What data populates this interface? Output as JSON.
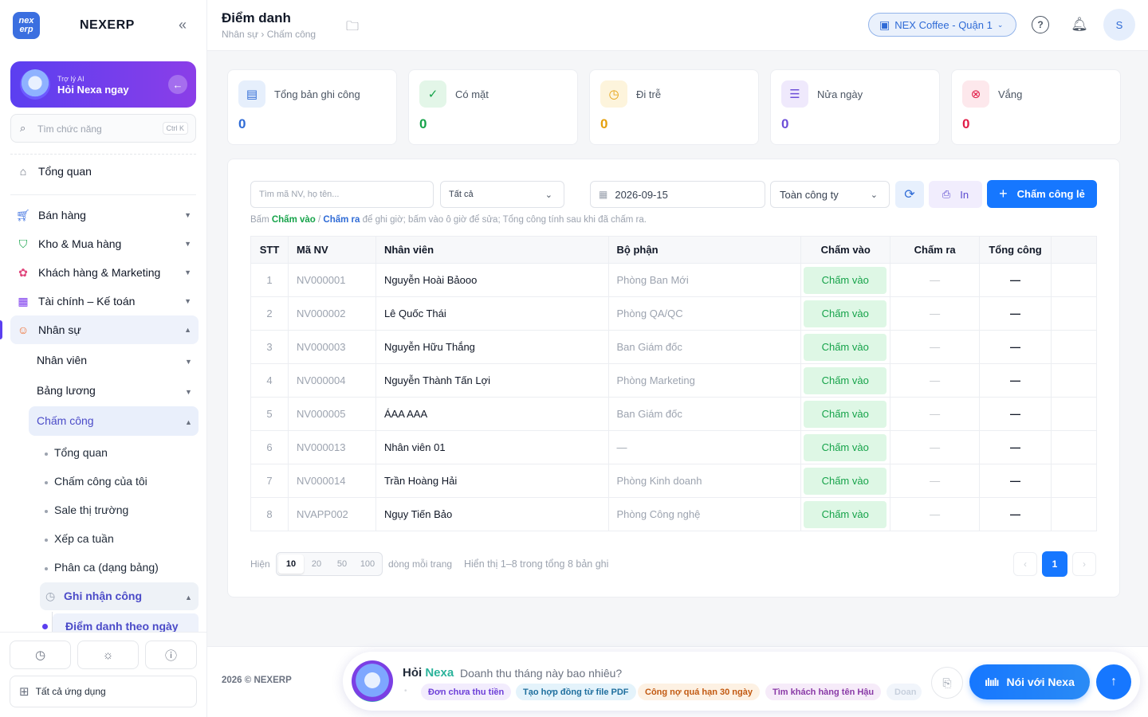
{
  "brand": {
    "logo_text_1": "nex",
    "logo_text_2": "erp",
    "name": "NEXERP",
    "collapse_icon": "double-chevron-left"
  },
  "ai": {
    "subtitle": "Trợ lý AI",
    "title": "Hỏi Nexa ngay"
  },
  "search": {
    "placeholder": "Tìm chức năng",
    "shortcut": "Ctrl K"
  },
  "nav": {
    "overview": "Tổng quan",
    "sales": "Bán hàng",
    "inventory": "Kho & Mua hàng",
    "crm": "Khách hàng & Marketing",
    "finance": "Tài chính – Kế toán",
    "hr": "Nhân sự",
    "hr_employees": "Nhân viên",
    "hr_payroll": "Bảng lương",
    "hr_timekeeping": "Chấm công",
    "tk_items": [
      "Tổng quan",
      "Chấm công của tôi",
      "Sale thị trường",
      "Xếp ca tuần",
      "Phân ca (dạng bảng)"
    ],
    "tk_record": "Ghi nhận công",
    "tk_daily": "Điểm danh theo ngày",
    "all_apps": "Tất cả ứng dụng"
  },
  "header": {
    "title": "Điểm danh",
    "breadcrumb": "Nhân sự › Chấm công",
    "store": "NEX Coffee - Quận 1",
    "user_initial": "S"
  },
  "stats": [
    {
      "label": "Tổng bản ghi công",
      "value": "0",
      "color": "#2f6bd6"
    },
    {
      "label": "Có mặt",
      "value": "0",
      "color": "#16a34a"
    },
    {
      "label": "Đi trễ",
      "value": "0",
      "color": "#e5a00d"
    },
    {
      "label": "Nửa ngày",
      "value": "0",
      "color": "#6d4ed8"
    },
    {
      "label": "Vắng",
      "value": "0",
      "color": "#e11d48"
    }
  ],
  "filters": {
    "search_placeholder": "Tìm mã NV, họ tên...",
    "status": "Tất cả",
    "date": "2026-09-15",
    "scope": "Toàn công ty",
    "print": "In",
    "add": "Chấm công lẻ"
  },
  "hint": {
    "p1": "Bấm ",
    "in": "Chấm vào",
    "sep": " / ",
    "out": "Chấm ra",
    "p2": " để ghi giờ; bấm vào ô giờ để sửa; Tổng công tính sau khi đã chấm ra."
  },
  "table": {
    "headers": [
      "STT",
      "Mã NV",
      "Nhân viên",
      "Bộ phận",
      "Chấm vào",
      "Chấm ra",
      "Tổng công"
    ],
    "rows": [
      {
        "stt": "1",
        "code": "NV000001",
        "name": "Nguyễn Hoài Bảooo",
        "dept": "Phòng Ban Mới",
        "in": "Chấm vào",
        "out": "—",
        "total": "—"
      },
      {
        "stt": "2",
        "code": "NV000002",
        "name": "Lê Quốc Thái",
        "dept": "Phòng QA/QC",
        "in": "Chấm vào",
        "out": "—",
        "total": "—"
      },
      {
        "stt": "3",
        "code": "NV000003",
        "name": "Nguyễn Hữu Thắng",
        "dept": "Ban Giám đốc",
        "in": "Chấm vào",
        "out": "—",
        "total": "—"
      },
      {
        "stt": "4",
        "code": "NV000004",
        "name": "Nguyễn Thành Tấn Lợi",
        "dept": "Phòng Marketing",
        "in": "Chấm vào",
        "out": "—",
        "total": "—"
      },
      {
        "stt": "5",
        "code": "NV000005",
        "name": "ÁAA AAA",
        "dept": "Ban Giám đốc",
        "in": "Chấm vào",
        "out": "—",
        "total": "—"
      },
      {
        "stt": "6",
        "code": "NV000013",
        "name": "Nhân viên 01",
        "dept": "—",
        "in": "Chấm vào",
        "out": "—",
        "total": "—"
      },
      {
        "stt": "7",
        "code": "NV000014",
        "name": "Trần Hoàng Hải",
        "dept": "Phòng Kinh doanh",
        "in": "Chấm vào",
        "out": "—",
        "total": "—"
      },
      {
        "stt": "8",
        "code": "NVAPP002",
        "name": "Ngụy Tiến Bảo",
        "dept": "Phòng Công nghệ",
        "in": "Chấm vào",
        "out": "—",
        "total": "—"
      }
    ]
  },
  "pagination": {
    "show_label": "Hiện",
    "sizes": [
      "10",
      "20",
      "50",
      "100"
    ],
    "selected": "10",
    "per_page_label": "dòng mỗi trang",
    "summary": "Hiển thị 1–8 trong tổng 8 bản ghi",
    "current_page": "1"
  },
  "footer": {
    "copyright": "2026 © NEXERP",
    "ask": "Hỏi",
    "nexa": "Nexa",
    "question": "Doanh thu tháng này bao nhiêu?",
    "chips": [
      "Đơn chưa thu tiền",
      "Tạo hợp đồng từ file PDF",
      "Công nợ quá hạn 30 ngày",
      "Tìm khách hàng tên Hậu",
      "Doan"
    ],
    "talk": "Nói với Nexa"
  }
}
